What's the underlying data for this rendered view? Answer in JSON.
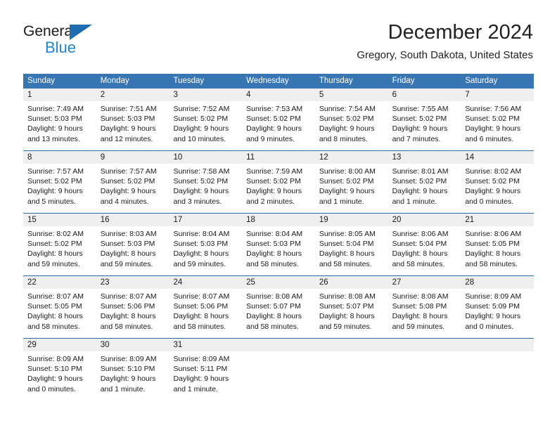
{
  "logo": {
    "word_top": "General",
    "word_bottom": "Blue",
    "triangle_color": "#1f6cb0",
    "bottom_color": "#2083d5"
  },
  "header": {
    "title": "December 2024",
    "subtitle": "Gregory, South Dakota, United States"
  },
  "colors": {
    "header_band": "#3775b3",
    "week_divider": "#2b6ca8",
    "daynum_band": "#efefef"
  },
  "weekdays": [
    "Sunday",
    "Monday",
    "Tuesday",
    "Wednesday",
    "Thursday",
    "Friday",
    "Saturday"
  ],
  "weeks": [
    {
      "days": [
        {
          "num": "1",
          "sunrise": "Sunrise: 7:49 AM",
          "sunset": "Sunset: 5:03 PM",
          "daylight1": "Daylight: 9 hours",
          "daylight2": "and 13 minutes."
        },
        {
          "num": "2",
          "sunrise": "Sunrise: 7:51 AM",
          "sunset": "Sunset: 5:03 PM",
          "daylight1": "Daylight: 9 hours",
          "daylight2": "and 12 minutes."
        },
        {
          "num": "3",
          "sunrise": "Sunrise: 7:52 AM",
          "sunset": "Sunset: 5:02 PM",
          "daylight1": "Daylight: 9 hours",
          "daylight2": "and 10 minutes."
        },
        {
          "num": "4",
          "sunrise": "Sunrise: 7:53 AM",
          "sunset": "Sunset: 5:02 PM",
          "daylight1": "Daylight: 9 hours",
          "daylight2": "and 9 minutes."
        },
        {
          "num": "5",
          "sunrise": "Sunrise: 7:54 AM",
          "sunset": "Sunset: 5:02 PM",
          "daylight1": "Daylight: 9 hours",
          "daylight2": "and 8 minutes."
        },
        {
          "num": "6",
          "sunrise": "Sunrise: 7:55 AM",
          "sunset": "Sunset: 5:02 PM",
          "daylight1": "Daylight: 9 hours",
          "daylight2": "and 7 minutes."
        },
        {
          "num": "7",
          "sunrise": "Sunrise: 7:56 AM",
          "sunset": "Sunset: 5:02 PM",
          "daylight1": "Daylight: 9 hours",
          "daylight2": "and 6 minutes."
        }
      ]
    },
    {
      "days": [
        {
          "num": "8",
          "sunrise": "Sunrise: 7:57 AM",
          "sunset": "Sunset: 5:02 PM",
          "daylight1": "Daylight: 9 hours",
          "daylight2": "and 5 minutes."
        },
        {
          "num": "9",
          "sunrise": "Sunrise: 7:57 AM",
          "sunset": "Sunset: 5:02 PM",
          "daylight1": "Daylight: 9 hours",
          "daylight2": "and 4 minutes."
        },
        {
          "num": "10",
          "sunrise": "Sunrise: 7:58 AM",
          "sunset": "Sunset: 5:02 PM",
          "daylight1": "Daylight: 9 hours",
          "daylight2": "and 3 minutes."
        },
        {
          "num": "11",
          "sunrise": "Sunrise: 7:59 AM",
          "sunset": "Sunset: 5:02 PM",
          "daylight1": "Daylight: 9 hours",
          "daylight2": "and 2 minutes."
        },
        {
          "num": "12",
          "sunrise": "Sunrise: 8:00 AM",
          "sunset": "Sunset: 5:02 PM",
          "daylight1": "Daylight: 9 hours",
          "daylight2": "and 1 minute."
        },
        {
          "num": "13",
          "sunrise": "Sunrise: 8:01 AM",
          "sunset": "Sunset: 5:02 PM",
          "daylight1": "Daylight: 9 hours",
          "daylight2": "and 1 minute."
        },
        {
          "num": "14",
          "sunrise": "Sunrise: 8:02 AM",
          "sunset": "Sunset: 5:02 PM",
          "daylight1": "Daylight: 9 hours",
          "daylight2": "and 0 minutes."
        }
      ]
    },
    {
      "days": [
        {
          "num": "15",
          "sunrise": "Sunrise: 8:02 AM",
          "sunset": "Sunset: 5:02 PM",
          "daylight1": "Daylight: 8 hours",
          "daylight2": "and 59 minutes."
        },
        {
          "num": "16",
          "sunrise": "Sunrise: 8:03 AM",
          "sunset": "Sunset: 5:03 PM",
          "daylight1": "Daylight: 8 hours",
          "daylight2": "and 59 minutes."
        },
        {
          "num": "17",
          "sunrise": "Sunrise: 8:04 AM",
          "sunset": "Sunset: 5:03 PM",
          "daylight1": "Daylight: 8 hours",
          "daylight2": "and 59 minutes."
        },
        {
          "num": "18",
          "sunrise": "Sunrise: 8:04 AM",
          "sunset": "Sunset: 5:03 PM",
          "daylight1": "Daylight: 8 hours",
          "daylight2": "and 58 minutes."
        },
        {
          "num": "19",
          "sunrise": "Sunrise: 8:05 AM",
          "sunset": "Sunset: 5:04 PM",
          "daylight1": "Daylight: 8 hours",
          "daylight2": "and 58 minutes."
        },
        {
          "num": "20",
          "sunrise": "Sunrise: 8:06 AM",
          "sunset": "Sunset: 5:04 PM",
          "daylight1": "Daylight: 8 hours",
          "daylight2": "and 58 minutes."
        },
        {
          "num": "21",
          "sunrise": "Sunrise: 8:06 AM",
          "sunset": "Sunset: 5:05 PM",
          "daylight1": "Daylight: 8 hours",
          "daylight2": "and 58 minutes."
        }
      ]
    },
    {
      "days": [
        {
          "num": "22",
          "sunrise": "Sunrise: 8:07 AM",
          "sunset": "Sunset: 5:05 PM",
          "daylight1": "Daylight: 8 hours",
          "daylight2": "and 58 minutes."
        },
        {
          "num": "23",
          "sunrise": "Sunrise: 8:07 AM",
          "sunset": "Sunset: 5:06 PM",
          "daylight1": "Daylight: 8 hours",
          "daylight2": "and 58 minutes."
        },
        {
          "num": "24",
          "sunrise": "Sunrise: 8:07 AM",
          "sunset": "Sunset: 5:06 PM",
          "daylight1": "Daylight: 8 hours",
          "daylight2": "and 58 minutes."
        },
        {
          "num": "25",
          "sunrise": "Sunrise: 8:08 AM",
          "sunset": "Sunset: 5:07 PM",
          "daylight1": "Daylight: 8 hours",
          "daylight2": "and 58 minutes."
        },
        {
          "num": "26",
          "sunrise": "Sunrise: 8:08 AM",
          "sunset": "Sunset: 5:07 PM",
          "daylight1": "Daylight: 8 hours",
          "daylight2": "and 59 minutes."
        },
        {
          "num": "27",
          "sunrise": "Sunrise: 8:08 AM",
          "sunset": "Sunset: 5:08 PM",
          "daylight1": "Daylight: 8 hours",
          "daylight2": "and 59 minutes."
        },
        {
          "num": "28",
          "sunrise": "Sunrise: 8:09 AM",
          "sunset": "Sunset: 5:09 PM",
          "daylight1": "Daylight: 9 hours",
          "daylight2": "and 0 minutes."
        }
      ]
    },
    {
      "days": [
        {
          "num": "29",
          "sunrise": "Sunrise: 8:09 AM",
          "sunset": "Sunset: 5:10 PM",
          "daylight1": "Daylight: 9 hours",
          "daylight2": "and 0 minutes."
        },
        {
          "num": "30",
          "sunrise": "Sunrise: 8:09 AM",
          "sunset": "Sunset: 5:10 PM",
          "daylight1": "Daylight: 9 hours",
          "daylight2": "and 1 minute."
        },
        {
          "num": "31",
          "sunrise": "Sunrise: 8:09 AM",
          "sunset": "Sunset: 5:11 PM",
          "daylight1": "Daylight: 9 hours",
          "daylight2": "and 1 minute."
        },
        {
          "num": "",
          "sunrise": "",
          "sunset": "",
          "daylight1": "",
          "daylight2": ""
        },
        {
          "num": "",
          "sunrise": "",
          "sunset": "",
          "daylight1": "",
          "daylight2": ""
        },
        {
          "num": "",
          "sunrise": "",
          "sunset": "",
          "daylight1": "",
          "daylight2": ""
        },
        {
          "num": "",
          "sunrise": "",
          "sunset": "",
          "daylight1": "",
          "daylight2": ""
        }
      ]
    }
  ]
}
